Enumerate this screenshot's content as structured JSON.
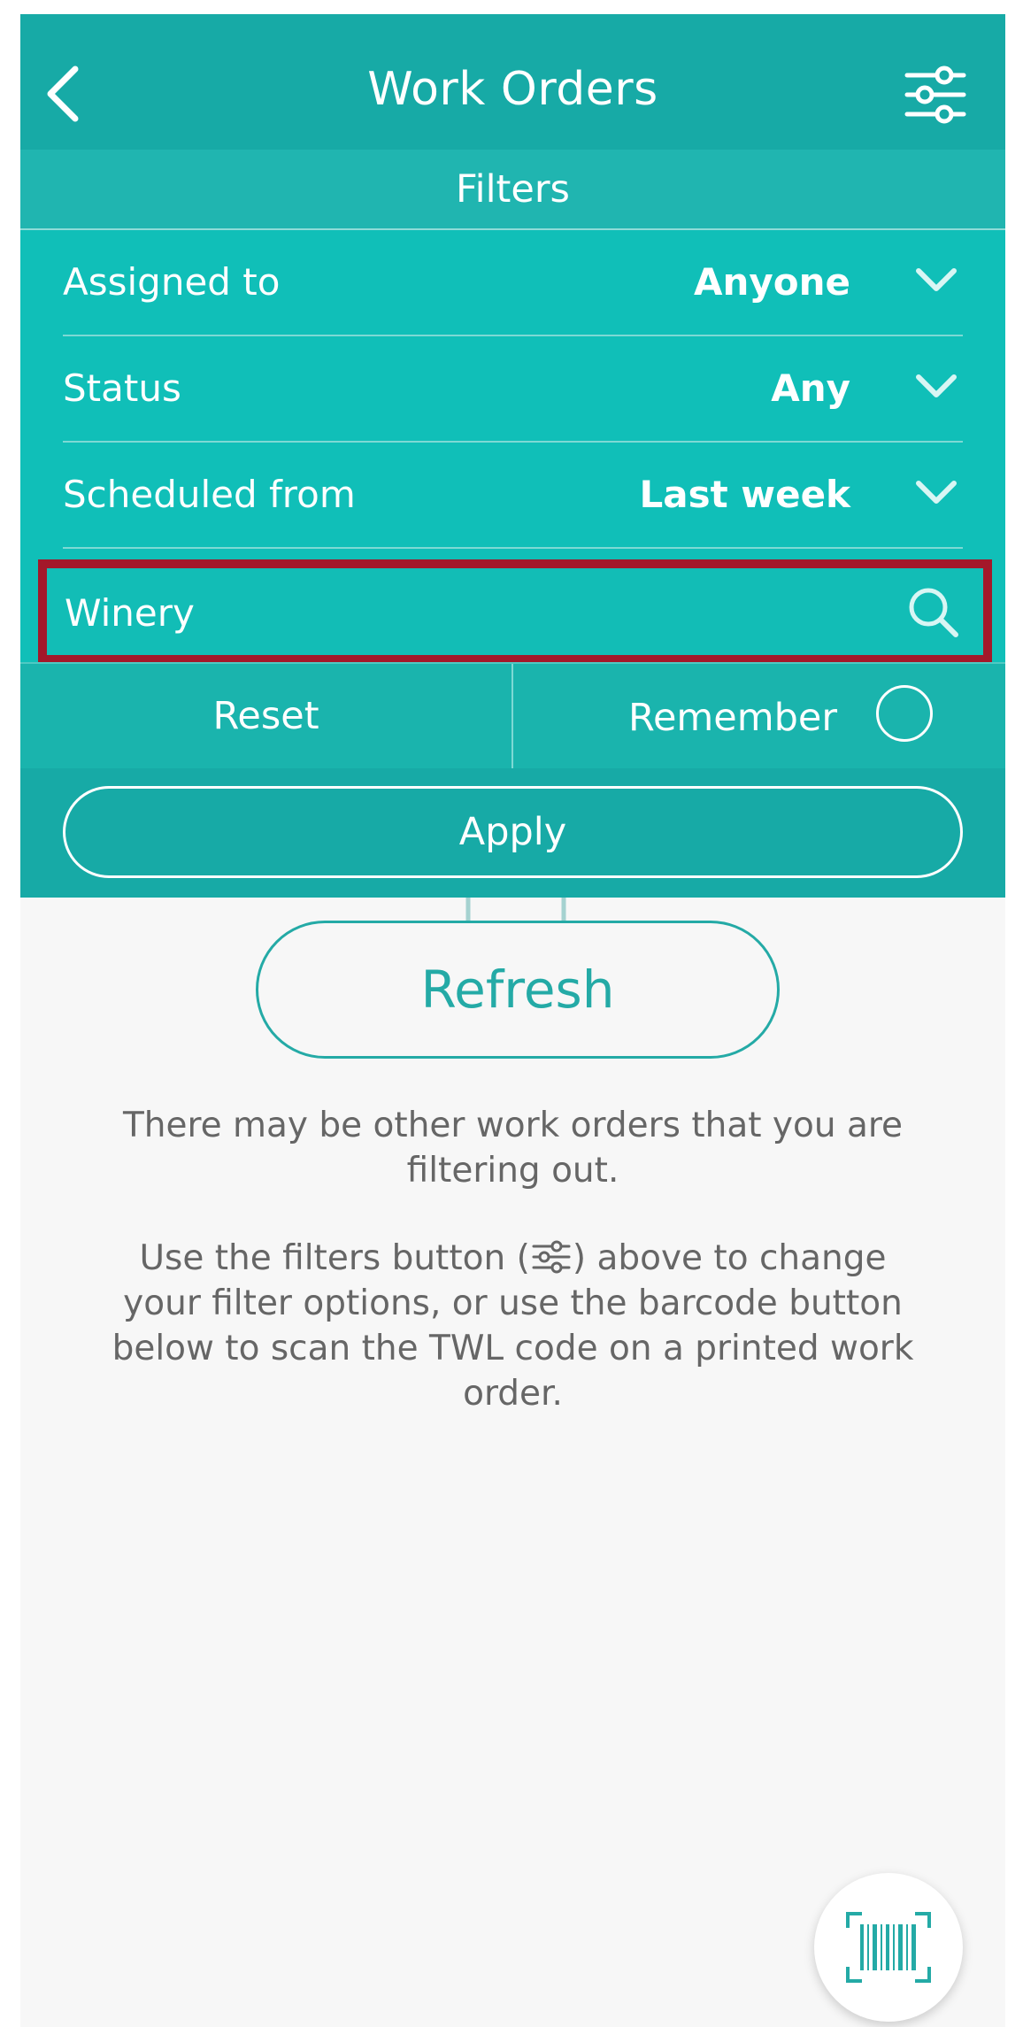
{
  "header": {
    "title": "Work Orders",
    "back_icon": "chevron-left-icon",
    "filter_icon": "sliders-icon"
  },
  "filters": {
    "section_label": "Filters",
    "rows": [
      {
        "label": "Assigned to",
        "value": "Anyone"
      },
      {
        "label": "Status",
        "value": "Any"
      },
      {
        "label": "Scheduled from",
        "value": "Last week"
      }
    ],
    "search": {
      "value": "Winery",
      "placeholder": ""
    },
    "reset_label": "Reset",
    "remember_label": "Remember",
    "remember_checked": false,
    "apply_label": "Apply"
  },
  "body": {
    "refresh_label": "Refresh",
    "message_1": "There may be other work orders that you are filtering out.",
    "message_2a": "Use the filters button (",
    "message_2b": ") above to change your filter options, or use the barcode button below to scan the TWL code on a printed work order."
  },
  "colors": {
    "header": "#17aaa6",
    "panel": "#10bfb8",
    "highlight_border": "#a3182a",
    "accent": "#24aaa6",
    "text_muted": "#666666"
  }
}
